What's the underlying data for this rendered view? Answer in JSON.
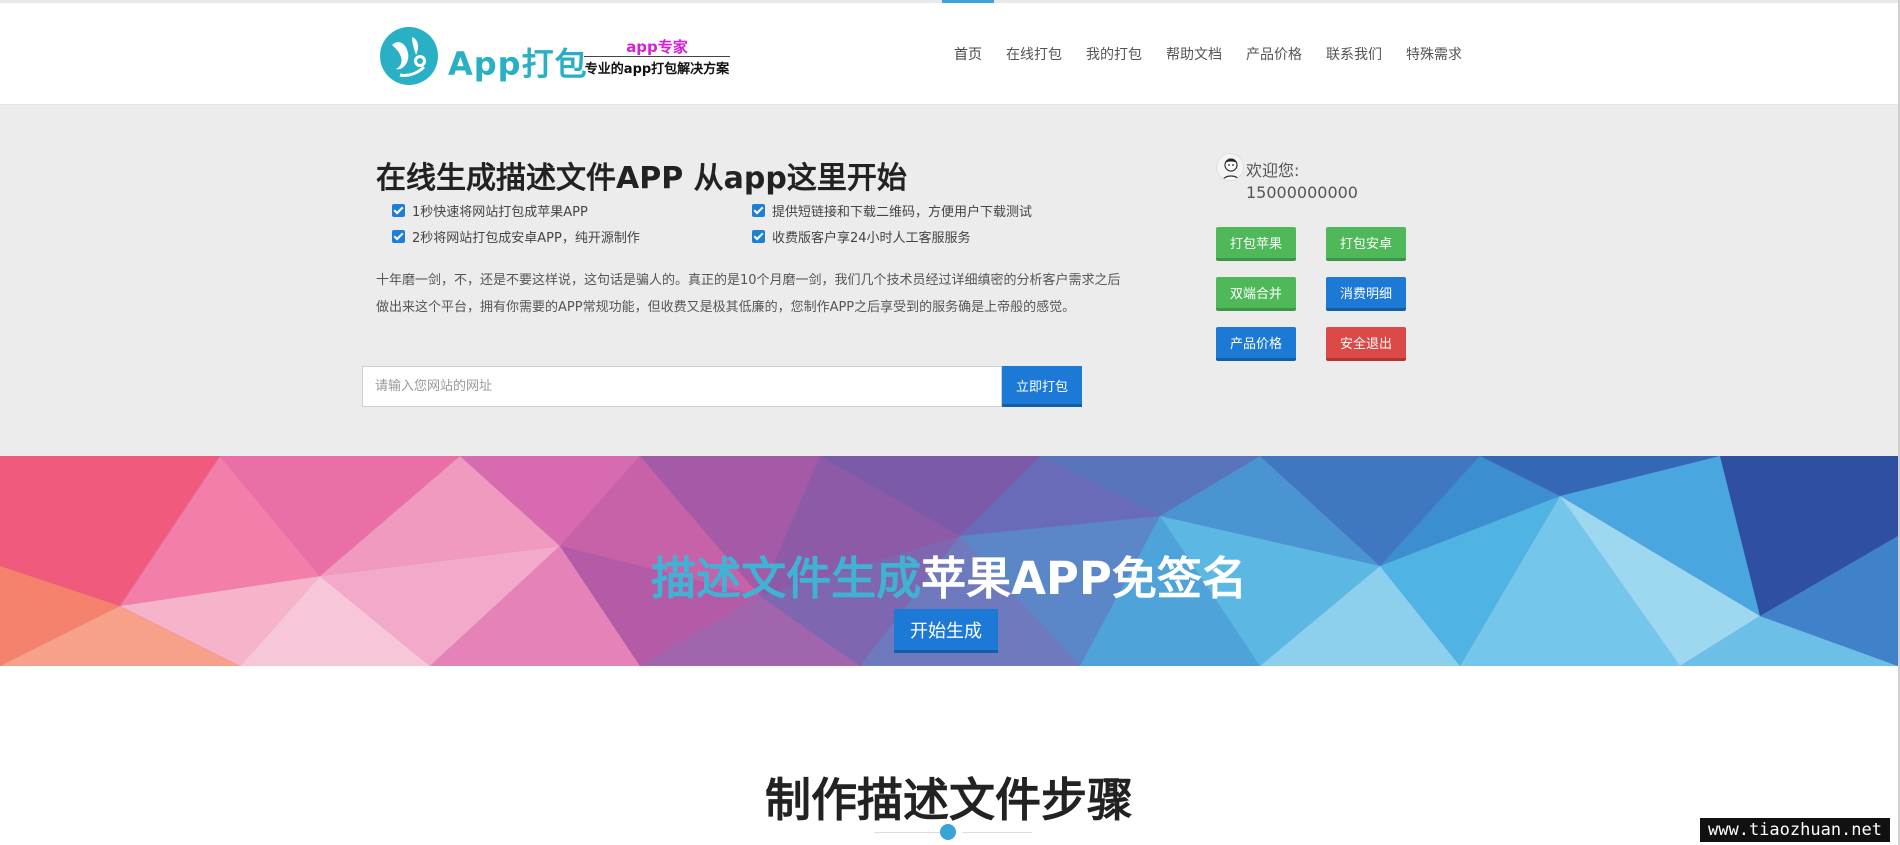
{
  "header": {
    "brand": "App打包",
    "slogan_top": "app专家",
    "slogan_bottom": "专业的app打包解决方案",
    "nav": [
      {
        "label": "首页",
        "active": true
      },
      {
        "label": "在线打包"
      },
      {
        "label": "我的打包"
      },
      {
        "label": "帮助文档"
      },
      {
        "label": "产品价格"
      },
      {
        "label": "联系我们"
      },
      {
        "label": "特殊需求"
      }
    ]
  },
  "hero": {
    "title": "在线生成描述文件APP 从app这里开始",
    "features": [
      "1秒快速将网站打包成苹果APP",
      "提供短链接和下载二维码，方便用户下载测试",
      "2秒将网站打包成安卓APP，纯开源制作",
      "收费版客户享24小时人工客服服务"
    ],
    "description": "十年磨一剑，不，还是不要这样说，这句话是骗人的。真正的是10个月磨一剑，我们几个技术员经过详细缜密的分析客户需求之后做出来这个平台，拥有你需要的APP常规功能，但收费又是极其低廉的，您制作APP之后享受到的服务确是上帝般的感觉。",
    "url_placeholder": "请输入您网站的网址",
    "url_value": "",
    "pack_button": "立即打包"
  },
  "user": {
    "welcome": "欢迎您:",
    "phone": "15000000000",
    "buttons": {
      "pack_ios": "打包苹果",
      "pack_android": "打包安卓",
      "dual_merge": "双端合并",
      "consumption": "消费明细",
      "pricing": "产品价格",
      "logout": "安全退出"
    }
  },
  "banner": {
    "title_accent": "描述文件生成",
    "title_rest": "苹果APP免签名",
    "start_button": "开始生成"
  },
  "steps": {
    "title": "制作描述文件步骤"
  },
  "watermark": "www.tiaozhuan.net",
  "colors": {
    "accent": "#3aa4d8",
    "primary_button": "#1c7ad6",
    "green_button": "#4fb95a",
    "red_button": "#dc4a47",
    "hero_bg": "#ececec",
    "brand": "#2ab0c4"
  }
}
